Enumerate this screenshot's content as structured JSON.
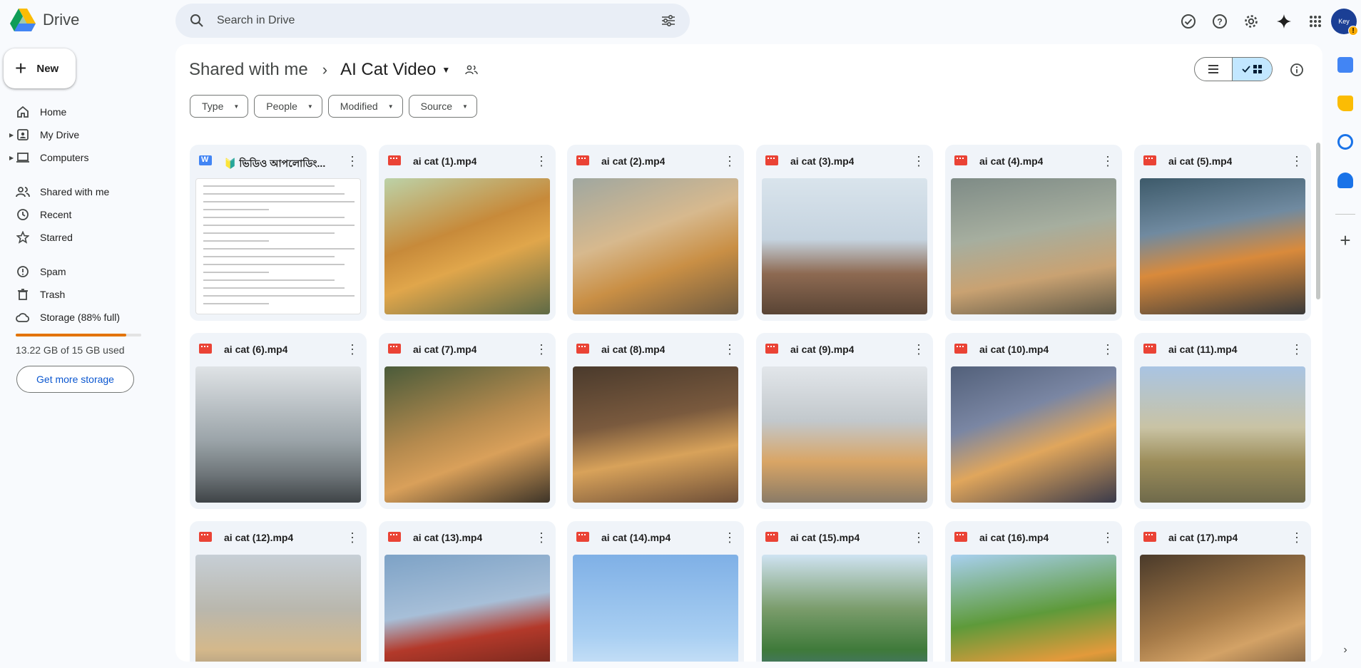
{
  "app": {
    "name": "Drive"
  },
  "search": {
    "placeholder": "Search in Drive"
  },
  "top_icons": [
    "offline-check-icon",
    "help-icon",
    "settings-icon",
    "gemini-icon",
    "apps-grid-icon"
  ],
  "account": {
    "initials": "Key",
    "badge": "!"
  },
  "sidebar": {
    "new_label": "New",
    "items": [
      {
        "label": "Home",
        "icon": "home-icon"
      },
      {
        "label": "My Drive",
        "icon": "my-drive-icon"
      },
      {
        "label": "Computers",
        "icon": "computers-icon"
      },
      {
        "label": "Shared with me",
        "icon": "shared-icon"
      },
      {
        "label": "Recent",
        "icon": "recent-icon"
      },
      {
        "label": "Starred",
        "icon": "star-icon"
      },
      {
        "label": "Spam",
        "icon": "spam-icon"
      },
      {
        "label": "Trash",
        "icon": "trash-icon"
      },
      {
        "label": "Storage (88% full)",
        "icon": "cloud-icon"
      }
    ],
    "storage": {
      "used_fraction": 0.88,
      "text": "13.22 GB of 15 GB used",
      "button": "Get more storage"
    }
  },
  "breadcrumb": {
    "parent": "Shared with me",
    "current": "AI Cat Video"
  },
  "filters": [
    "Type",
    "People",
    "Modified",
    "Source"
  ],
  "files": [
    {
      "name": "🔰 ভিডিও আপলোডিং...",
      "type": "doc"
    },
    {
      "name": "ai cat (1).mp4",
      "type": "video"
    },
    {
      "name": "ai cat (2).mp4",
      "type": "video"
    },
    {
      "name": "ai cat (3).mp4",
      "type": "video"
    },
    {
      "name": "ai cat (4).mp4",
      "type": "video"
    },
    {
      "name": "ai cat (5).mp4",
      "type": "video"
    },
    {
      "name": "ai cat (6).mp4",
      "type": "video"
    },
    {
      "name": "ai cat (7).mp4",
      "type": "video"
    },
    {
      "name": "ai cat (8).mp4",
      "type": "video"
    },
    {
      "name": "ai cat (9).mp4",
      "type": "video"
    },
    {
      "name": "ai cat (10).mp4",
      "type": "video"
    },
    {
      "name": "ai cat (11).mp4",
      "type": "video"
    },
    {
      "name": "ai cat (12).mp4",
      "type": "video"
    },
    {
      "name": "ai cat (13).mp4",
      "type": "video"
    },
    {
      "name": "ai cat (14).mp4",
      "type": "video"
    },
    {
      "name": "ai cat (15).mp4",
      "type": "video"
    },
    {
      "name": "ai cat (16).mp4",
      "type": "video"
    },
    {
      "name": "ai cat (17).mp4",
      "type": "video"
    }
  ],
  "colors": {
    "storage_fill": "#e37400",
    "accent": "#0b57d0",
    "selected_view": "#c2e7ff"
  }
}
